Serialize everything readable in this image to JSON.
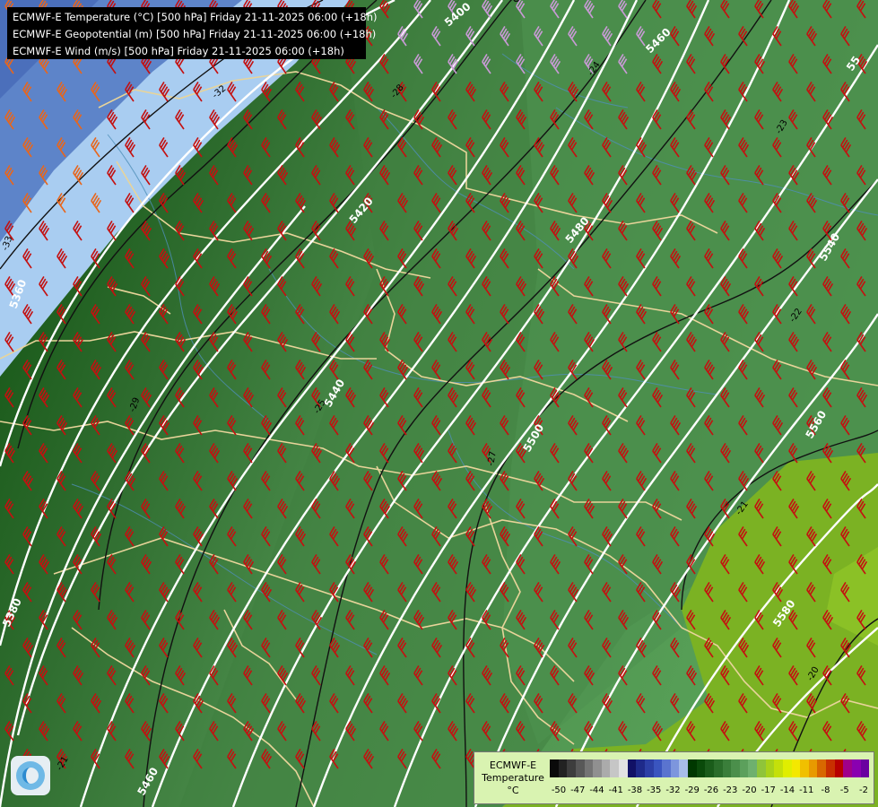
{
  "header": {
    "lines": [
      "ECMWF-E Temperature (°C) [500 hPa] Friday 21-11-2025 06:00 (+18h)",
      "ECMWF-E Geopotential (m) [500 hPa] Friday 21-11-2025 06:00 (+18h)",
      "ECMWF-E Wind (m/s) [500 hPa] Friday 21-11-2025 06:00 (+18h)"
    ]
  },
  "geopotential_labels": [
    "5400",
    "5460",
    "55",
    "5420",
    "5480",
    "5540",
    "5360",
    "5440",
    "5500",
    "5560",
    "5380",
    "5580",
    "5460"
  ],
  "temperature_labels": [
    "-32",
    "-28",
    "-24",
    "-23",
    "-33",
    "-29",
    "-25",
    "-22",
    "-21",
    "-20",
    "-27",
    "-21"
  ],
  "legend": {
    "title_lines": [
      "ECMWF-E",
      "Temperature",
      "°C"
    ],
    "ticks": [
      "-50",
      "-47",
      "-44",
      "-41",
      "-38",
      "-35",
      "-32",
      "-29",
      "-26",
      "-23",
      "-20",
      "-17",
      "-14",
      "-11",
      "-8",
      "-5",
      "-2"
    ],
    "colors": [
      "#0a0a0a",
      "#222222",
      "#3d3d3d",
      "#585858",
      "#747474",
      "#909090",
      "#ababab",
      "#c6c6c6",
      "#e2e2e2",
      "#111166",
      "#1e2a8a",
      "#2c3fa6",
      "#3a55bf",
      "#5a74cf",
      "#7d96dd",
      "#a8bde9",
      "#003800",
      "#0a4a0a",
      "#1a5c1a",
      "#2a6d2a",
      "#3a7e3a",
      "#4b8f4b",
      "#5ca05c",
      "#6eb06e",
      "#8fc43a",
      "#a8d21a",
      "#c4e00a",
      "#e0ee00",
      "#f4e800",
      "#f0c000",
      "#e89a00",
      "#d86800",
      "#c83000",
      "#b80000",
      "#a0008a",
      "#8a00b0",
      "#6a00a0"
    ]
  },
  "logo": {
    "name": "ecmwf-logo"
  },
  "colors": {
    "land_cold": "#0b4f0b",
    "land_mid": "#3c7d3c",
    "land_warm": "#4f924f",
    "very_warm": "#7cb31f",
    "cold_blue": "#5d86cc",
    "cold_light": "#a8ccf2",
    "barb_red": "#c41010",
    "barb_orange": "#e8661c",
    "barb_lilac": "#c99ad6",
    "border": "#e8d49a",
    "river": "#4f8fb8"
  }
}
